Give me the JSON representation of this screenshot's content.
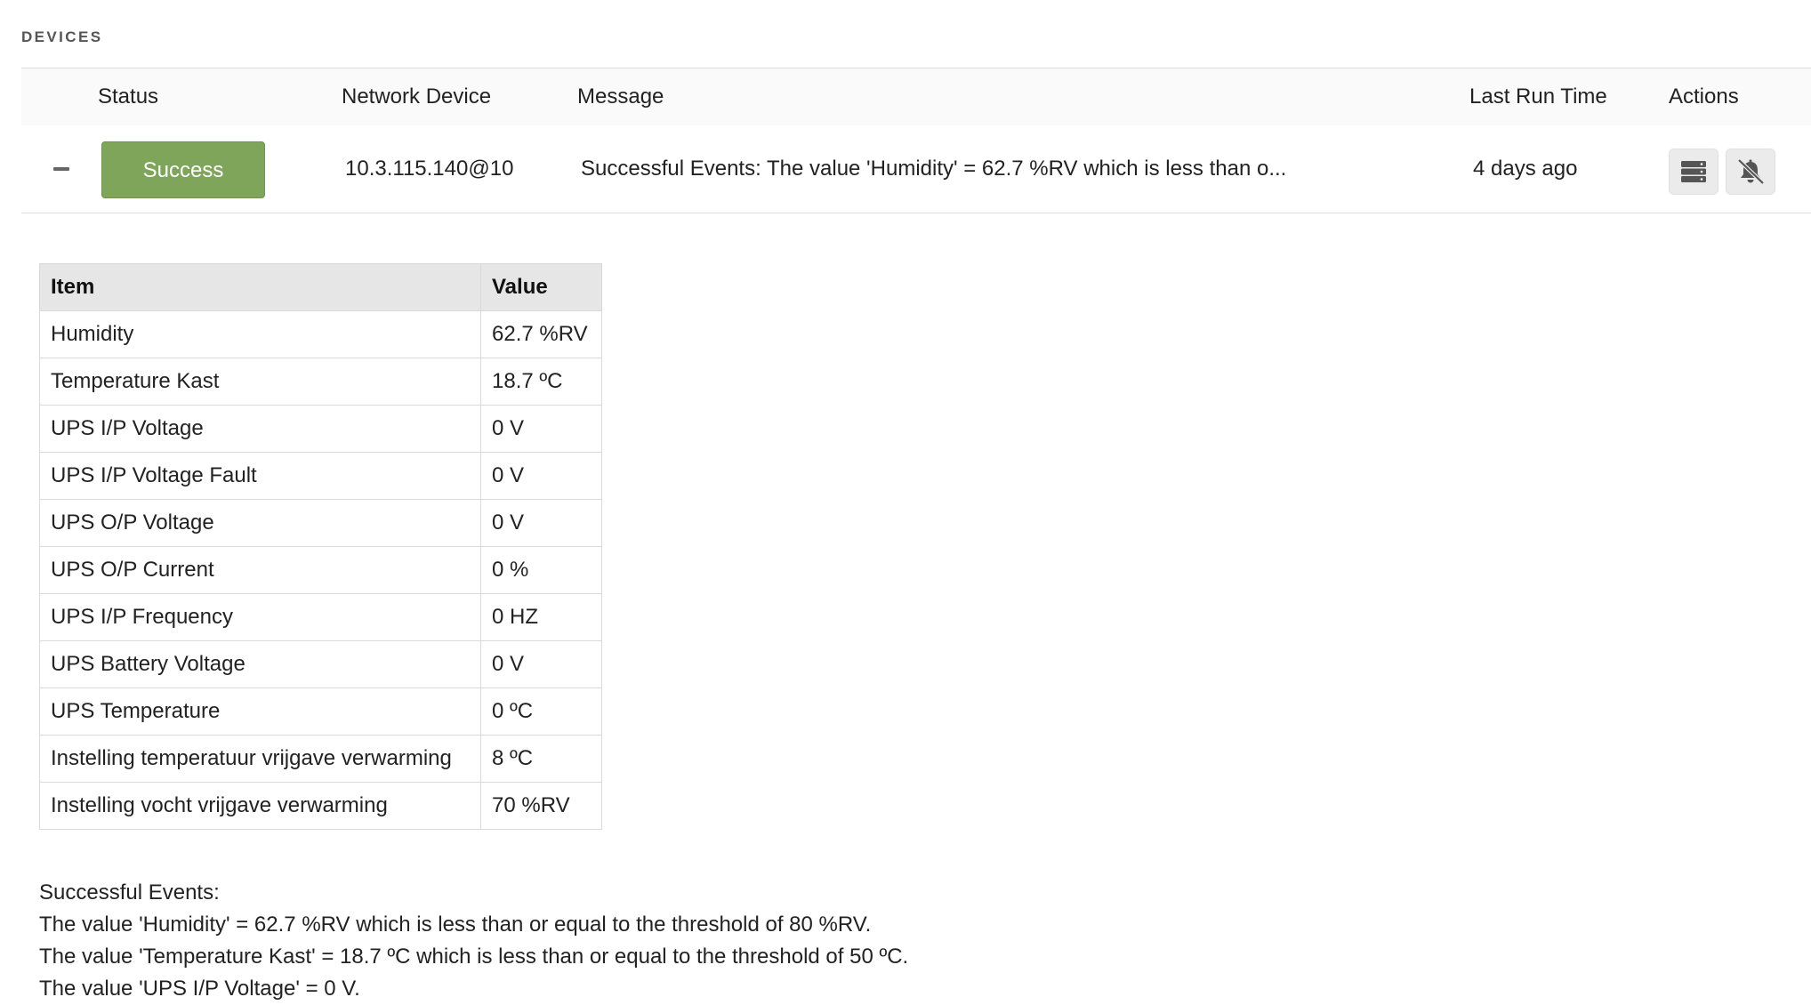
{
  "section": {
    "title": "DEVICES"
  },
  "columns": {
    "status": "Status",
    "network_device": "Network Device",
    "message": "Message",
    "last_run_time": "Last Run Time",
    "actions": "Actions"
  },
  "row": {
    "toggle_icon": "minus-icon",
    "status": "Success",
    "network_device": "10.3.115.140@10",
    "message": "Successful Events: The value 'Humidity' = 62.7 %RV which is less than o...",
    "last_run_time": "4 days ago",
    "actions": [
      {
        "icon": "server-icon"
      },
      {
        "icon": "bell-slash-icon"
      }
    ]
  },
  "detail_table": {
    "headers": [
      "Item",
      "Value"
    ],
    "rows": [
      [
        "Humidity",
        "62.7 %RV"
      ],
      [
        "Temperature Kast",
        "18.7 ºC"
      ],
      [
        "UPS I/P Voltage",
        "0 V"
      ],
      [
        "UPS I/P Voltage Fault",
        "0 V"
      ],
      [
        "UPS O/P Voltage",
        "0 V"
      ],
      [
        "UPS O/P Current",
        "0 %"
      ],
      [
        "UPS I/P Frequency",
        "0 HZ"
      ],
      [
        "UPS Battery Voltage",
        "0 V"
      ],
      [
        "UPS Temperature",
        "0 ºC"
      ],
      [
        "Instelling temperatuur vrijgave verwarming",
        "8 ºC"
      ],
      [
        "Instelling vocht vrijgave verwarming",
        "70 %RV"
      ]
    ]
  },
  "events": [
    "Successful Events:",
    "The value 'Humidity' = 62.7 %RV which is less than or equal to the threshold of 80 %RV.",
    "The value 'Temperature Kast' = 18.7 ºC which is less than or equal to the threshold of 50 ºC.",
    "The value 'UPS I/P Voltage' = 0 V."
  ],
  "colors": {
    "success": "#7ea55a",
    "header_bg": "#e6e6e6",
    "border": "#d9d9d9"
  }
}
